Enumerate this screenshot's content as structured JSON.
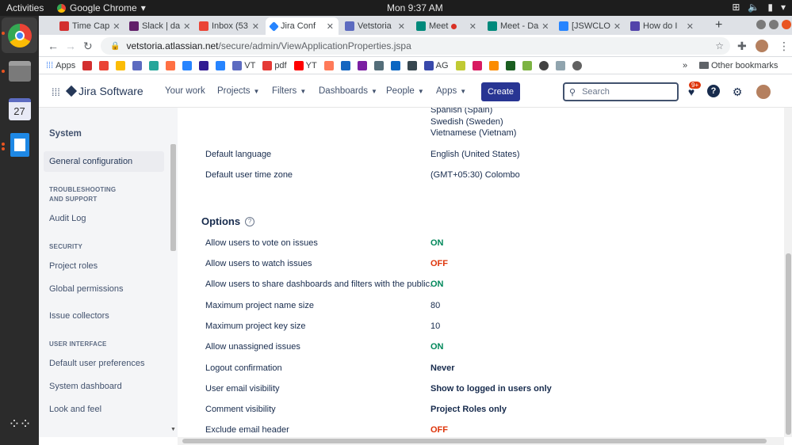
{
  "system_bar": {
    "activities": "Activities",
    "app_name": "Google Chrome",
    "clock": "Mon  9:37 AM"
  },
  "tabs": [
    {
      "label": "Time Cap",
      "color": "#d32f2f"
    },
    {
      "label": "Slack | da",
      "color": "#611f69"
    },
    {
      "label": "Inbox (53",
      "color": "#ea4335"
    },
    {
      "label": "Jira Conf",
      "color": "#2684ff"
    },
    {
      "label": "Vetstoria",
      "color": "#5c6bc0"
    },
    {
      "label": "Meet",
      "color": "#00897b"
    },
    {
      "label": "Meet - Da",
      "color": "#00897b"
    },
    {
      "label": "[JSWCLO",
      "color": "#2684ff"
    },
    {
      "label": "How do I",
      "color": "#5243aa"
    }
  ],
  "address": {
    "domain": "vetstoria.atlassian.net",
    "path": "/secure/admin/ViewApplicationProperties.jspa"
  },
  "bookmarks": {
    "items": [
      "Apps",
      "VT",
      "pdf",
      "YT",
      "AG"
    ],
    "other": "Other bookmarks"
  },
  "jira_nav": {
    "product": "Jira Software",
    "your_work": "Your work",
    "projects": "Projects",
    "filters": "Filters",
    "dashboards": "Dashboards",
    "people": "People",
    "apps": "Apps",
    "create": "Create",
    "search_placeholder": "Search",
    "notif_badge": "9+"
  },
  "sidebar": {
    "system": "System",
    "general_configuration": "General configuration",
    "troubleshooting_header": "TROUBLESHOOTING AND SUPPORT",
    "audit_log": "Audit Log",
    "security_header": "SECURITY",
    "project_roles": "Project roles",
    "global_permissions": "Global permissions",
    "issue_collectors": "Issue collectors",
    "user_interface_header": "USER INTERFACE",
    "default_user_preferences": "Default user preferences",
    "system_dashboard": "System dashboard",
    "look_and_feel": "Look and feel"
  },
  "languages_tail": [
    "Spanish (Spain)",
    "Swedish (Sweden)",
    "Vietnamese (Vietnam)"
  ],
  "settings": [
    {
      "label": "Default language",
      "value": "English (United States)"
    },
    {
      "label": "Default user time zone",
      "value": "(GMT+05:30) Colombo"
    }
  ],
  "options_title": "Options",
  "options": [
    {
      "label": "Allow users to vote on issues",
      "value": "ON",
      "kind": "on"
    },
    {
      "label": "Allow users to watch issues",
      "value": "OFF",
      "kind": "off"
    },
    {
      "label": "Allow users to share dashboards and filters with the public.",
      "value": "ON",
      "kind": "on"
    },
    {
      "label": "Maximum project name size",
      "value": "80",
      "kind": "plain"
    },
    {
      "label": "Maximum project key size",
      "value": "10",
      "kind": "plain"
    },
    {
      "label": "Allow unassigned issues",
      "value": "ON",
      "kind": "on"
    },
    {
      "label": "Logout confirmation",
      "value": "Never",
      "kind": "bold"
    },
    {
      "label": "User email visibility",
      "value": "Show to logged in users only",
      "kind": "bold"
    },
    {
      "label": "Comment visibility",
      "value": "Project Roles only",
      "kind": "bold"
    },
    {
      "label": "Exclude email header",
      "value": "OFF",
      "kind": "off"
    }
  ]
}
